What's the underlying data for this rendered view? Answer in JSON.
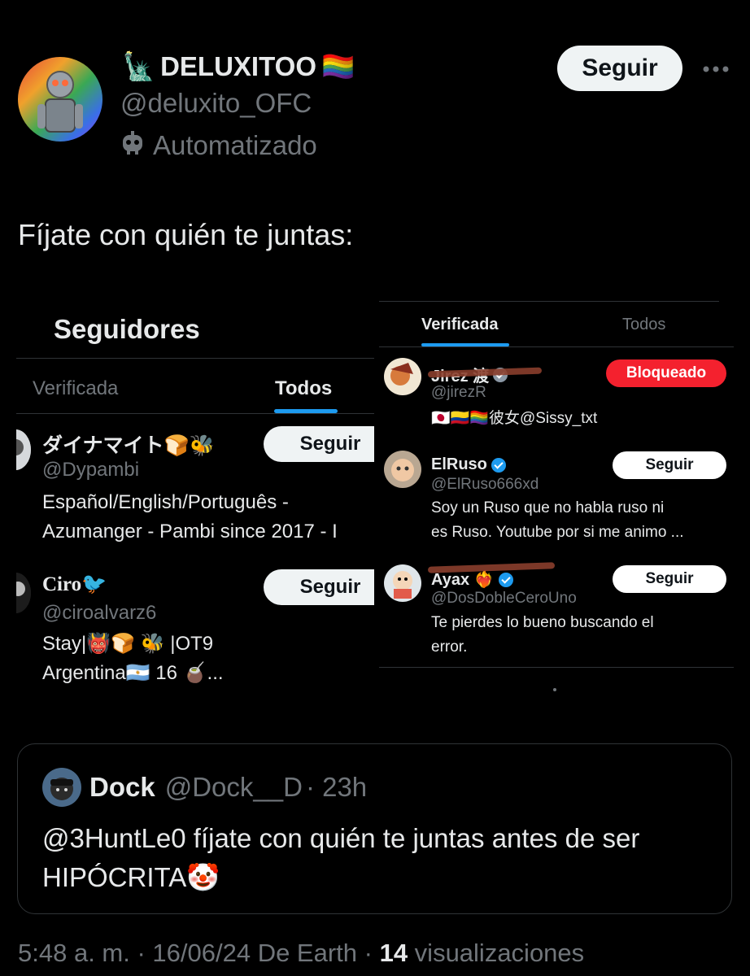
{
  "author": {
    "name": "DELUXITOO",
    "name_prefix_emoji": "🗽",
    "name_suffix_emoji": "🏳️‍🌈",
    "handle": "@deluxito_OFC",
    "automated_label": "Automatizado",
    "follow_label": "Seguir",
    "more_icon": "more-icon"
  },
  "tweet": {
    "text": "Fíjate con quién te juntas:"
  },
  "left_screenshot": {
    "title": "Seguidores",
    "tabs": [
      "Verificada",
      "Todos"
    ],
    "rows": [
      {
        "name": "ダイナマイト🍞🐝",
        "handle": "@Dypambi",
        "bio_line1": "Español/English/Português -",
        "bio_line2": "Azumanger - Pambi since 2017 - I",
        "follow_label": "Seguir"
      },
      {
        "name": "Ciro🐦",
        "handle": "@ciroalvarz6",
        "bio_line1": "Stay|👹🍞 🐝 |OT9",
        "bio_line2": "Argentina🇦🇷 16 🧉...",
        "follow_label": "Seguir"
      }
    ]
  },
  "right_screenshot": {
    "tabs": [
      "Verificada",
      "Todos"
    ],
    "rows": [
      {
        "name": "Jirez 渡",
        "handle": "@jirezR",
        "bio_line1": "🇯🇵🇨🇴🏳️‍🌈彼女@Sissy_txt",
        "bio_line2": "",
        "button_label": "Bloqueado",
        "button_type": "blocked"
      },
      {
        "name": "ElRuso",
        "handle": "@ElRuso666xd",
        "bio_line1": "Soy un Ruso que no habla ruso ni",
        "bio_line2": "es Ruso. Youtube por si me animo ...",
        "button_label": "Seguir",
        "button_type": "follow"
      },
      {
        "name": "Ayax ❤️‍🔥",
        "handle": "@DosDobleCeroUno",
        "bio_line1": "Te pierdes lo bueno buscando el",
        "bio_line2": "error.",
        "button_label": "Seguir",
        "button_type": "follow"
      }
    ]
  },
  "quoted_tweet": {
    "name": "Dock",
    "handle": "@Dock__D",
    "time": "· 23h",
    "text_line1": "@3HuntLe0 fíjate con quién te juntas antes de ser",
    "text_line2": "HIPÓCRITA🤡"
  },
  "footer": {
    "time": "5:48 a. m.",
    "date_source": " · 16/06/24 De Earth · ",
    "views_count": "14",
    "views_label": " visualizaciones"
  },
  "colors": {
    "background": "#000000",
    "text_primary": "#e7e9ea",
    "text_secondary": "#71767b",
    "accent_blue": "#1d9bf0",
    "blocked_red": "#f4212e"
  }
}
